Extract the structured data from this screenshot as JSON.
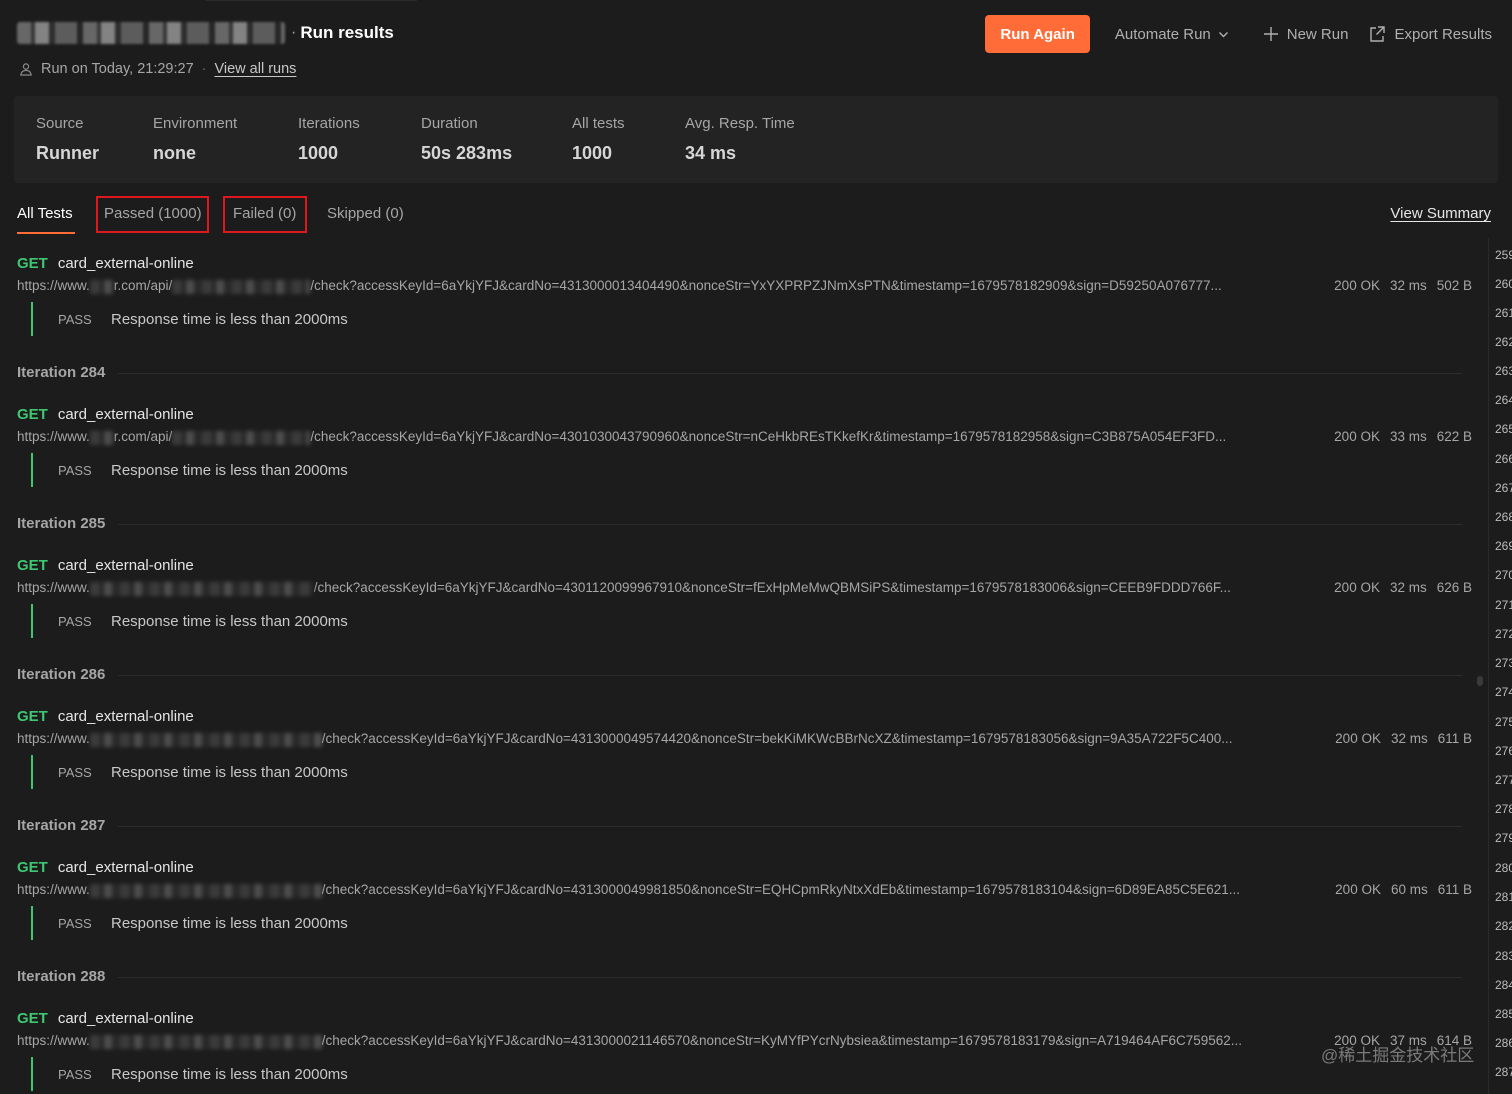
{
  "header": {
    "title": "Run results",
    "title_separator": "·",
    "run_info": "Run on Today, 21:29:27",
    "view_all_runs": "View all runs",
    "meta_separator": "·"
  },
  "actions": {
    "run_again": "Run Again",
    "automate_run": "Automate Run",
    "new_run": "New Run",
    "export_results": "Export Results"
  },
  "summary": [
    {
      "label": "Source",
      "value": "Runner"
    },
    {
      "label": "Environment",
      "value": "none"
    },
    {
      "label": "Iterations",
      "value": "1000"
    },
    {
      "label": "Duration",
      "value": "50s 283ms"
    },
    {
      "label": "All tests",
      "value": "1000"
    },
    {
      "label": "Avg. Resp. Time",
      "value": "34 ms"
    }
  ],
  "tabs": [
    {
      "label": "All Tests",
      "active": true
    },
    {
      "label": "Passed (1000)",
      "highlighted": true
    },
    {
      "label": "Failed (0)",
      "highlighted": true
    },
    {
      "label": "Skipped (0)"
    }
  ],
  "view_summary": "View Summary",
  "colors": {
    "accent": "#ff6c37",
    "get_method": "#3ec773",
    "highlight_box": "#e0181e",
    "background": "#1c1c1c"
  },
  "requests": [
    {
      "method": "GET",
      "name": "card_external-online",
      "url_prefix": "https://www.",
      "url_visible": "r.com/api/",
      "url_rest": "/check?accessKeyId=6aYkjYFJ&cardNo=4313000013404490&nonceStr=YxYXPRPZJNmXsPTN&timestamp=1679578182909&sign=D59250A076777...",
      "status": "200 OK",
      "time": "32 ms",
      "size": "502 B",
      "test_status": "PASS",
      "test_name": "Response time is less than 2000ms"
    },
    {
      "method": "GET",
      "name": "card_external-online",
      "url_prefix": "https://www.",
      "url_visible": "r.com/api/",
      "url_rest": "/check?accessKeyId=6aYkjYFJ&cardNo=4301030043790960&nonceStr=nCeHkbREsTKkefKr&timestamp=1679578182958&sign=C3B875A054EF3FD...",
      "status": "200 OK",
      "time": "33 ms",
      "size": "622 B",
      "test_status": "PASS",
      "test_name": "Response time is less than 2000ms"
    },
    {
      "method": "GET",
      "name": "card_external-online",
      "url_prefix": "https://www.",
      "url_visible": "",
      "url_rest": "/check?accessKeyId=6aYkjYFJ&cardNo=4301120099967910&nonceStr=fExHpMeMwQBMSiPS&timestamp=1679578183006&sign=CEEB9FDDD766F...",
      "status": "200 OK",
      "time": "32 ms",
      "size": "626 B",
      "test_status": "PASS",
      "test_name": "Response time is less than 2000ms"
    },
    {
      "method": "GET",
      "name": "card_external-online",
      "url_prefix": "https://www.",
      "url_visible": "",
      "url_rest": "/check?accessKeyId=6aYkjYFJ&cardNo=4313000049574420&nonceStr=bekKiMKWcBBrNcXZ&timestamp=1679578183056&sign=9A35A722F5C400...",
      "status": "200 OK",
      "time": "32 ms",
      "size": "611 B",
      "test_status": "PASS",
      "test_name": "Response time is less than 2000ms"
    },
    {
      "method": "GET",
      "name": "card_external-online",
      "url_prefix": "https://www.",
      "url_visible": "",
      "url_rest": "/check?accessKeyId=6aYkjYFJ&cardNo=4313000049981850&nonceStr=EQHCpmRkyNtxXdEb&timestamp=1679578183104&sign=6D89EA85C5E621...",
      "status": "200 OK",
      "time": "60 ms",
      "size": "611 B",
      "test_status": "PASS",
      "test_name": "Response time is less than 2000ms"
    },
    {
      "method": "GET",
      "name": "card_external-online",
      "url_prefix": "https://www.",
      "url_visible": "",
      "url_rest": "/check?accessKeyId=6aYkjYFJ&cardNo=4313000021146570&nonceStr=KyMYfPYcrNybsiea&timestamp=1679578183179&sign=A719464AF6C759562...",
      "status": "200 OK",
      "time": "37 ms",
      "size": "614 B",
      "test_status": "PASS",
      "test_name": "Response time is less than 2000ms"
    }
  ],
  "iterations": [
    "Iteration 284",
    "Iteration 285",
    "Iteration 286",
    "Iteration 287",
    "Iteration 288"
  ],
  "gutter_numbers": [
    "259",
    "260",
    "261",
    "262",
    "263",
    "264",
    "265",
    "266",
    "267",
    "268",
    "269",
    "270",
    "271",
    "272",
    "273",
    "274",
    "275",
    "276",
    "277",
    "278",
    "279",
    "280",
    "281",
    "282",
    "283",
    "284",
    "285",
    "286",
    "287"
  ],
  "watermark": "@稀土掘金技术社区"
}
